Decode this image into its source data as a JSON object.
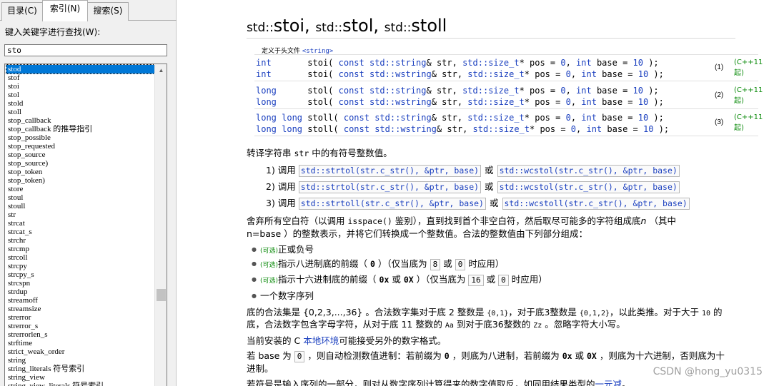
{
  "tabs": [
    {
      "label": "目录(C)"
    },
    {
      "label": "索引(N)"
    },
    {
      "label": "搜索(S)"
    }
  ],
  "search": {
    "label": "键入关键字进行查找(W):",
    "value": "sto"
  },
  "index_list": [
    "stod",
    "stof",
    "stoi",
    "stol",
    "stold",
    "stoll",
    "stop_callback",
    "stop_callback 的推导指引",
    "stop_possible",
    "stop_requested",
    "stop_source",
    "stop_source)",
    "stop_token",
    "stop_token)",
    "store",
    "stoul",
    "stoull",
    "str",
    "strcat",
    "strcat_s",
    "strchr",
    "strcmp",
    "strcoll",
    "strcpy",
    "strcpy_s",
    "strcspn",
    "strdup",
    "streamoff",
    "streamsize",
    "strerror",
    "strerror_s",
    "strerrorlen_s",
    "strftime",
    "strict_weak_order",
    "string",
    "string_literals 符号索引",
    "string_view",
    "string_view_literals 符号索引"
  ],
  "page": {
    "title_ns": "std::",
    "title_parts": [
      "stoi",
      "stol",
      "stoll"
    ],
    "title_sep": ", ",
    "def_header_text": "定义于头文件 ",
    "def_header_name": "<string>",
    "decls": [
      {
        "num": "(1)",
        "since": "(C++11 起)",
        "lines": [
          {
            "ret": "int",
            "name": "stoi",
            "strtype": "std::string"
          },
          {
            "ret": "int",
            "name": "stoi",
            "strtype": "std::wstring"
          }
        ]
      },
      {
        "num": "(2)",
        "since": "(C++11 起)",
        "lines": [
          {
            "ret": "long",
            "name": "stol",
            "strtype": "std::string"
          },
          {
            "ret": "long",
            "name": "stol",
            "strtype": "std::wstring"
          }
        ]
      },
      {
        "num": "(3)",
        "since": "(C++11 起)",
        "lines": [
          {
            "ret": "long long",
            "name": "stoll",
            "strtype": "std::string"
          },
          {
            "ret": "long long",
            "name": "stoll",
            "strtype": "std::wstring"
          }
        ]
      }
    ],
    "code": {
      "const": "const",
      "amp": "&",
      "str": "str",
      "comma": ", ",
      "size_t": "std::size_t",
      "star_pos": "* pos = ",
      "zero": "0",
      "int_kw": "int",
      "base_eq": " base = ",
      "ten": "10",
      "end": " );",
      "open": "( "
    },
    "desc_pre": "转译字符串 ",
    "desc_code": "str",
    "desc_post": " 中的有符号整数值。",
    "calls": [
      {
        "label": "1) 调用",
        "a": "std::strtol(str.c_str(), &ptr, base)",
        "or": "或",
        "b": "std::wcstol(str.c_str(), &ptr, base)"
      },
      {
        "label": "2) 调用",
        "a": "std::strtol(str.c_str(), &ptr, base)",
        "or": "或",
        "b": "std::wcstol(str.c_str(), &ptr, base)"
      },
      {
        "label": "3) 调用",
        "a": "std::strtoll(str.c_str(), &ptr, base)",
        "or": "或",
        "b": "std::wcstoll(str.c_str(), &ptr, base)"
      }
    ],
    "p1_a": "舍弃所有空白符（以调用 ",
    "p1_code": "isspace()",
    "p1_b": " 鉴别），直到找到首个非空白符，然后取尽可能多的字符组成底",
    "p1_n": "n",
    "p1_c": " （其中",
    "p1_line2": "n=base ）的整数表示，并将它们转换成一个整数值。合法的整数值由下列部分组成：",
    "bullets": {
      "b1_opt": "(可选)",
      "b1_text": "正或负号",
      "b2_opt": "(可选)",
      "b2_text": "指示八进制底的前缀（ ",
      "b2_code": "0",
      "b2_mid": " ）（仅当底为 ",
      "b2_n1": "8",
      "b2_or": " 或 ",
      "b2_n2": "0",
      "b2_end": " 时应用）",
      "b3_opt": "(可选)",
      "b3_text": "指示十六进制底的前缀（ ",
      "b3_code1": "0x",
      "b3_or1": " 或 ",
      "b3_code2": "0X",
      "b3_mid": " ）（仅当底为 ",
      "b3_n1": "16",
      "b3_or": " 或 ",
      "b3_n2": "0",
      "b3_end": " 时应用）",
      "b4_text": "一个数字序列"
    },
    "p2_a": "底的合法集是 {0,2,3,...,36} 。合法数字集对于底 2 整数是 ",
    "p2_c1": "{0,1}",
    "p2_b": "，对于底3整数是 ",
    "p2_c2": "{0,1,2}",
    "p2_c": "，以此类推。对于大于 ",
    "p2_c3": "10",
    "p2_d": " 的",
    "p2_line2_a": "底，合法数字包含字母字符，从对于底 11 整数的 ",
    "p2_c4": "Aa",
    "p2_line2_b": " 到对于底36整数的 ",
    "p2_c5": "Zz",
    "p2_line2_c": " 。忽略字符大小写。",
    "p3_a": "当前安装的 C ",
    "p3_link": "本地环境",
    "p3_b": "可能接受另外的数字格式。",
    "p4_a": "若 base 为 ",
    "p4_n": "0",
    "p4_b": " ，则自动检测数值进制：若前缀为 ",
    "p4_c1": "0",
    "p4_c": " ，则底为八进制，若前缀为 ",
    "p4_c2": "0x",
    "p4_or": " 或 ",
    "p4_c3": "0X",
    "p4_d": " ，则底为十六进制，否则底为十",
    "p4_line2": "进制。",
    "p5_a": "若符号是输入序列的一部分，则对从数字序列计算得来的数字值取反，如同用结果类型的",
    "p5_link": "一元减",
    "p5_b": "。"
  },
  "watermark": "CSDN @hong_yu0315"
}
